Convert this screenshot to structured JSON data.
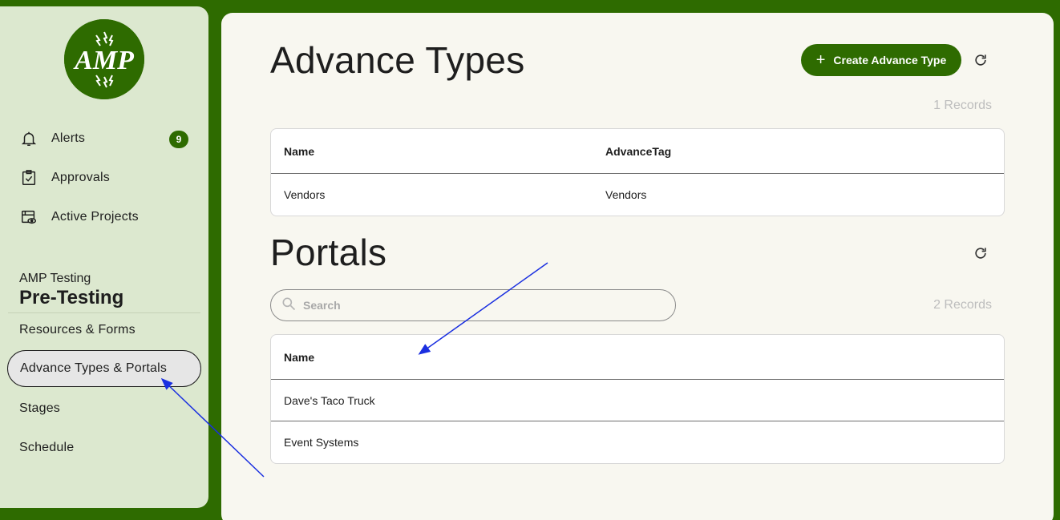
{
  "sidebar": {
    "logo_text": "AMP",
    "nav": [
      {
        "label": "Alerts",
        "icon": "bell-icon",
        "badge": "9"
      },
      {
        "label": "Approvals",
        "icon": "clipboard-check-icon"
      },
      {
        "label": "Active Projects",
        "icon": "project-view-icon"
      }
    ],
    "org_name": "AMP Testing",
    "project_name": "Pre-Testing",
    "project_nav": [
      {
        "label": "Resources & Forms"
      },
      {
        "label": "Advance Types & Portals",
        "active": true
      },
      {
        "label": "Stages"
      },
      {
        "label": "Schedule"
      }
    ]
  },
  "advance_types": {
    "title": "Advance Types",
    "create_label": "Create Advance Type",
    "records": "1 Records",
    "columns": [
      "Name",
      "AdvanceTag"
    ],
    "rows": [
      [
        "Vendors",
        "Vendors"
      ]
    ]
  },
  "portals": {
    "title": "Portals",
    "search_placeholder": "Search",
    "records": "2 Records",
    "columns": [
      "Name"
    ],
    "rows": [
      [
        "Dave's Taco Truck"
      ],
      [
        "Event Systems"
      ]
    ]
  },
  "colors": {
    "brand": "#2e6b00",
    "sidebar_bg": "#dce8cf",
    "main_bg": "#f8f7f0",
    "annotation_arrow": "#1a2fe0"
  }
}
